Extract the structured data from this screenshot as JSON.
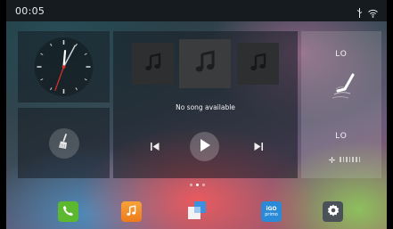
{
  "status_bar": {
    "time": "00:05",
    "icons": [
      "usb-icon",
      "wifi-icon"
    ]
  },
  "clock": {
    "hour_hand_angle_deg": 5,
    "minute_hand_angle_deg": 28,
    "second_hand_angle_deg": 200
  },
  "music": {
    "now_playing": "No song available",
    "albums": [
      "music-note-icon",
      "music-note-icon",
      "music-note-icon"
    ]
  },
  "climate": {
    "temp_top": "LO",
    "temp_bottom": "LO",
    "fan_level": 0
  },
  "pager": {
    "pages": 3,
    "active_index": 1
  },
  "dock": {
    "items": [
      "phone-icon",
      "music-icon",
      "screen-mirror-icon",
      "igo-navigation-icon",
      "settings-icon"
    ],
    "igo_label_top": "iGO",
    "igo_label_bottom": "primo"
  },
  "colors": {
    "phone": "#5cb82e",
    "music": "#f29030",
    "navigation": "#2a8ad8",
    "settings": "#4a5158"
  }
}
